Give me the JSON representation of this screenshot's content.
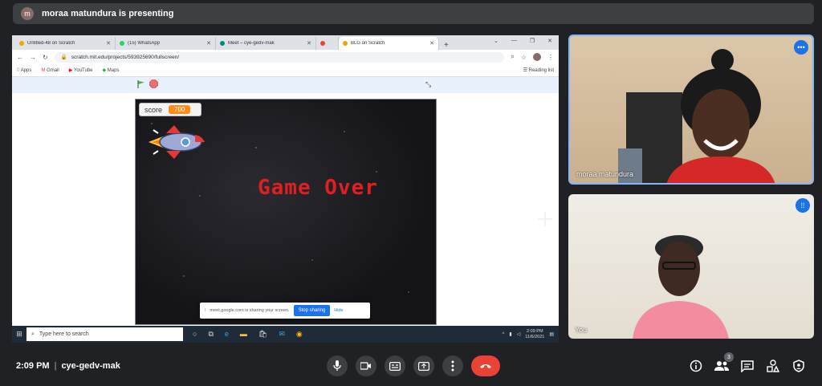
{
  "banner": {
    "avatar_letter": "m",
    "text": "moraa matundura is presenting"
  },
  "browser": {
    "tabs": [
      {
        "label": "Untitled-48 on Scratch",
        "color": "#f4a300"
      },
      {
        "label": "(15) WhatsApp",
        "color": "#25d366"
      },
      {
        "label": "Meet – cye-gedv-mak",
        "color": "#00897b"
      },
      {
        "label": "",
        "color": "#ea4335"
      },
      {
        "label": "BLG on Scratch",
        "color": "#f4a300"
      }
    ],
    "url": "scratch.mit.edu/projects/593925690/fullscreen/",
    "bookmarks": [
      "Apps",
      "Gmail",
      "YouTube",
      "Maps"
    ],
    "reading_list": "Reading list"
  },
  "game": {
    "score_label": "score",
    "score_value": "700",
    "message": "Game Over"
  },
  "share_bar": {
    "text": "meet.google.com is sharing your screen.",
    "stop": "Stop sharing",
    "hide": "Hide"
  },
  "taskbar": {
    "search_placeholder": "Type here to search",
    "time": "2:09 PM",
    "date": "11/6/2021"
  },
  "participants": [
    {
      "name": "moraa matundura"
    },
    {
      "name": "You"
    }
  ],
  "meeting": {
    "time": "2:09 PM",
    "code": "cye-gedv-mak",
    "people_count": "3"
  }
}
